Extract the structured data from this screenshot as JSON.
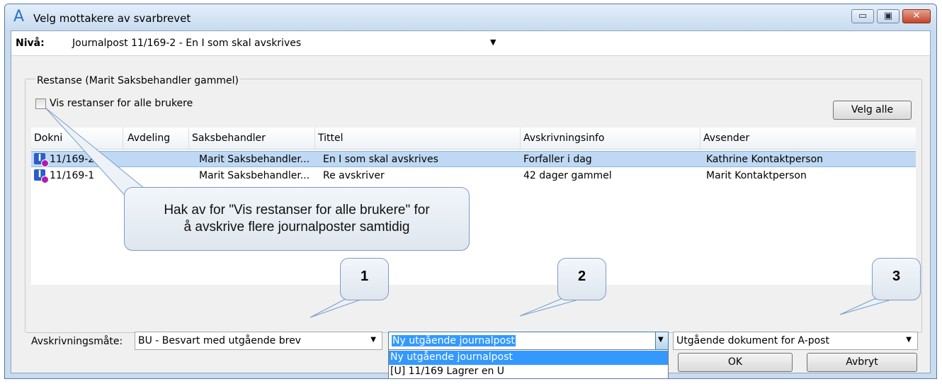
{
  "window": {
    "title": "Velg mottakere av svarbrevet",
    "icon": "A",
    "controls": {
      "minimize": "▭",
      "maximize": "▣",
      "close": "✕"
    }
  },
  "niva": {
    "label": "Nivå:",
    "value": "Journalpost 11/169-2 - En I som skal avskrives"
  },
  "restanse": {
    "group_title": "Restanse (Marit Saksbehandler gammel)",
    "checkbox_label": "Vis restanser for alle brukere",
    "checked": false,
    "velg_alle": "Velg alle"
  },
  "table": {
    "headers": [
      "Dokni",
      "Avdeling",
      "Saksbehandler",
      "Tittel",
      "Avskrivningsinfo",
      "Avsender"
    ],
    "rows": [
      {
        "doknr": "11/169-2",
        "avdeling": "",
        "saksbehandler": "Marit Saksbehandler...",
        "tittel": "En I som skal avskrives",
        "avskrivningsinfo": "Forfaller i dag",
        "avsender": "Kathrine Kontaktperson",
        "selected": true
      },
      {
        "doknr": "11/169-1",
        "avdeling": "",
        "saksbehandler": "Marit Saksbehandler...",
        "tittel": "Re avskriver",
        "avskrivningsinfo": "42 dager gammel",
        "avsender": "Marit Kontaktperson",
        "selected": false
      }
    ]
  },
  "bottom": {
    "avskrivningsmate_label": "Avskrivningsmåte:",
    "avskrivningsmate_value": "BU - Besvart med utgående brev",
    "journalpost_value": "Ny utgående journalpost",
    "dokument_value": "Utgående dokument for  A-post",
    "dropdown_options": [
      "Ny utgående journalpost",
      "[U] 11/169 Lagrer en U"
    ],
    "ok": "OK",
    "avbryt": "Avbryt"
  },
  "callouts": {
    "main_text_line1": "Hak av for \"Vis restanser for alle brukere\" for",
    "main_text_line2": "å avskrive flere journalposter samtidig",
    "n1": "1",
    "n2": "2",
    "n3": "3"
  },
  "colors": {
    "selection": "#bfd8f3",
    "highlight": "#3399ff",
    "titlebar": "#c8dbf0"
  }
}
